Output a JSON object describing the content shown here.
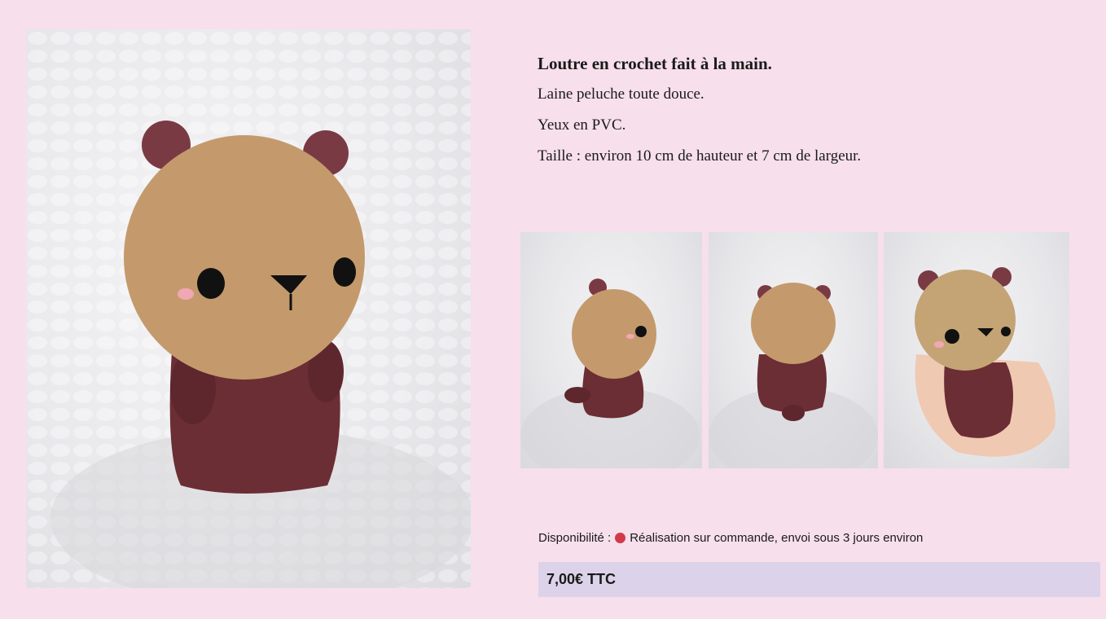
{
  "product": {
    "description": {
      "title": "Loutre en crochet fait à la main.",
      "lines": [
        "Laine peluche toute douce.",
        "Yeux en PVC.",
        "Taille : environ 10 cm de hauteur et 7 cm de largeur."
      ]
    },
    "availability": {
      "label": "Disponibilité :",
      "status_color": "#d23a4a",
      "text": "Réalisation sur commande, envoi sous 3 jours environ"
    },
    "price": "7,00€ TTC"
  },
  "colors": {
    "background": "#f7dfeb",
    "price_box": "#dcd3ea",
    "plush_head": "#c49a6c",
    "plush_body": "#6b2e34"
  }
}
